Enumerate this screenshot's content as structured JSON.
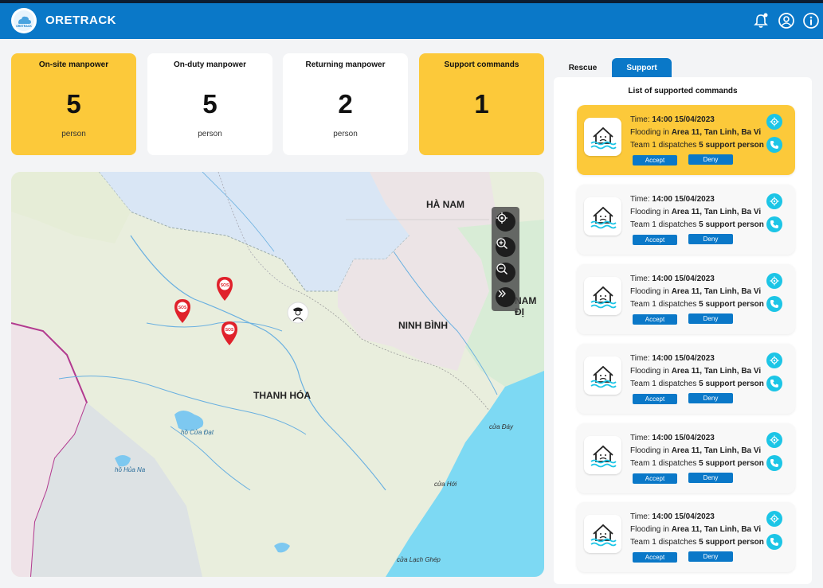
{
  "header": {
    "app_title": "ORETRACK",
    "logo_text": "ORETRACK",
    "icons": [
      "bell-icon",
      "user-icon",
      "info-icon"
    ]
  },
  "stats": [
    {
      "label": "On-site manpower",
      "value": "5",
      "unit": "person",
      "highlight": true
    },
    {
      "label": "On-duty manpower",
      "value": "5",
      "unit": "person",
      "highlight": false
    },
    {
      "label": "Returning manpower",
      "value": "2",
      "unit": "person",
      "highlight": false
    },
    {
      "label": "Support commands",
      "value": "1",
      "unit": "",
      "highlight": true
    }
  ],
  "map": {
    "labels": {
      "ha_nam": "HÀ NAM",
      "nam_dinh": "NAM ĐỊ",
      "ninh_binh": "NINH BÌNH",
      "thanh_hoa": "THANH HÓA",
      "ho_cua_dat": "hồ Cửa Đạt",
      "ho_hua_na": "hồ Hủa Na",
      "cua_day": "cửa Đáy",
      "cua_hoi": "cửa Hới",
      "cua_lach_ghep": "cửa Lạch Ghép",
      "sos": "SOS"
    },
    "controls": [
      "locate-icon",
      "zoom-in-icon",
      "zoom-out-icon",
      "expand-icon"
    ]
  },
  "tabs": [
    {
      "label": "Rescue",
      "active": false
    },
    {
      "label": "Support",
      "active": true
    }
  ],
  "panel": {
    "title": "List of supported commands",
    "commands": [
      {
        "time_label": "Time: ",
        "time": "14:00 15/04/2023",
        "event_prefix": "Flooding in ",
        "location": "Area 11, Tan Linh, Ba Vi",
        "team_prefix": "Team 1 dispatches ",
        "support": "5 support person",
        "accept": "Accept",
        "deny": "Deny",
        "active": true
      },
      {
        "time_label": "Time: ",
        "time": "14:00 15/04/2023",
        "event_prefix": "Flooding in ",
        "location": "Area 11, Tan Linh, Ba Vi",
        "team_prefix": "Team 1 dispatches ",
        "support": "5 support person",
        "accept": "Accept",
        "deny": "Deny",
        "active": false
      },
      {
        "time_label": "Time: ",
        "time": "14:00 15/04/2023",
        "event_prefix": "Flooding in ",
        "location": "Area 11, Tan Linh, Ba Vi",
        "team_prefix": "Team 1 dispatches ",
        "support": "5 support person",
        "accept": "Accept",
        "deny": "Deny",
        "active": false
      },
      {
        "time_label": "Time: ",
        "time": "14:00 15/04/2023",
        "event_prefix": "Flooding in ",
        "location": "Area 11, Tan Linh, Ba Vi",
        "team_prefix": "Team 1 dispatches ",
        "support": "5 support person",
        "accept": "Accept",
        "deny": "Deny",
        "active": false
      },
      {
        "time_label": "Time: ",
        "time": "14:00 15/04/2023",
        "event_prefix": "Flooding in ",
        "location": "Area 11, Tan Linh, Ba Vi",
        "team_prefix": "Team 1 dispatches ",
        "support": "5 support person",
        "accept": "Accept",
        "deny": "Deny",
        "active": false
      },
      {
        "time_label": "Time: ",
        "time": "14:00 15/04/2023",
        "event_prefix": "Flooding in ",
        "location": "Area 11, Tan Linh, Ba Vi",
        "team_prefix": "Team 1 dispatches ",
        "support": "5 support person",
        "accept": "Accept",
        "deny": "Deny",
        "active": false
      }
    ]
  },
  "colors": {
    "brand_blue": "#0a78c8",
    "highlight_yellow": "#fcc93a",
    "icon_cyan": "#1cc5e6",
    "sos_red": "#e0212b"
  }
}
